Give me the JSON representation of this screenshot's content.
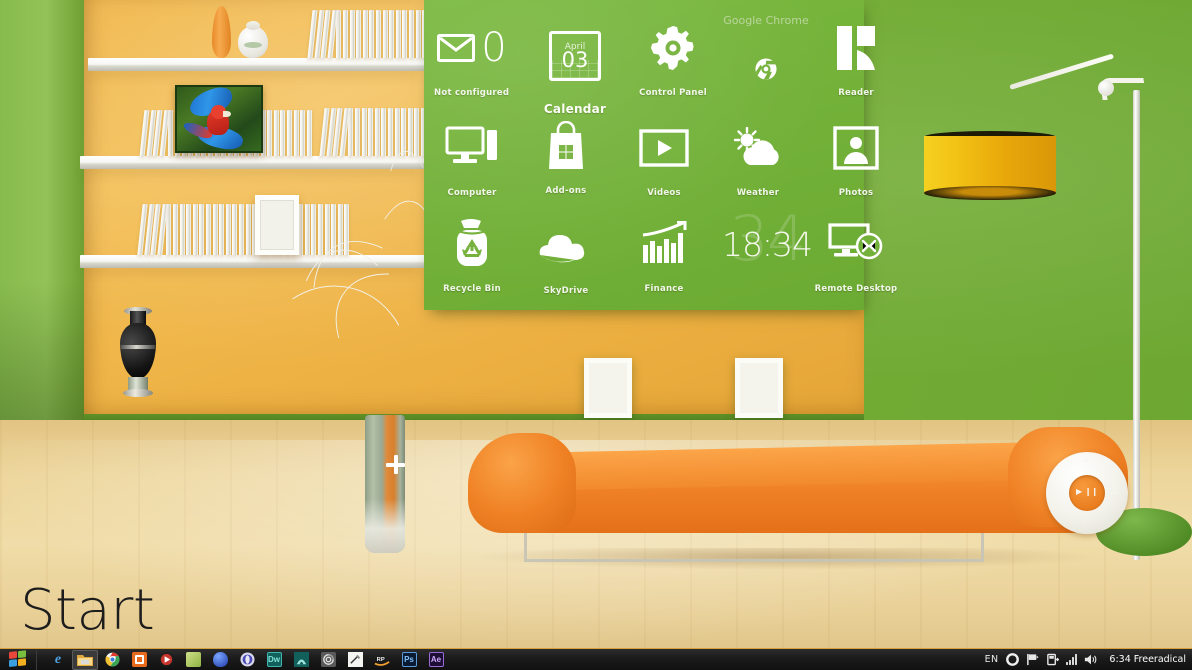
{
  "desktop": {
    "start_label": "Start",
    "wallpaper_name": "living-room-green-orange"
  },
  "tiles": [
    {
      "name": "mail",
      "label": "Not configured",
      "icon": "mail-icon",
      "count": "0",
      "label_style": "left"
    },
    {
      "name": "calendar",
      "label": "Calendar",
      "icon": "calendar-icon",
      "month": "April",
      "day": "03",
      "label_style": "big"
    },
    {
      "name": "control-panel",
      "label": "Control Panel",
      "icon": "gear-icon"
    },
    {
      "name": "google-chrome",
      "label": "Google Chrome",
      "icon": "chrome-icon",
      "label_style": "above"
    },
    {
      "name": "reader",
      "label": "Reader",
      "icon": "reader-icon"
    },
    {
      "name": "computer",
      "label": "Computer",
      "icon": "monitor-icon"
    },
    {
      "name": "add-ons",
      "label": "Add-ons",
      "icon": "shopping-bag-icon"
    },
    {
      "name": "videos",
      "label": "Videos",
      "icon": "play-box-icon"
    },
    {
      "name": "weather",
      "label": "Weather",
      "icon": "sun-cloud-icon"
    },
    {
      "name": "photos",
      "label": "Photos",
      "icon": "photo-person-icon"
    },
    {
      "name": "recycle-bin",
      "label": "Recycle Bin",
      "icon": "recycle-bin-icon"
    },
    {
      "name": "skydrive",
      "label": "SkyDrive",
      "icon": "cloud-icon"
    },
    {
      "name": "finance",
      "label": "Finance",
      "icon": "bar-chart-arrow-icon"
    },
    {
      "name": "clock",
      "label": "",
      "icon": "clock-tile",
      "time": "18:34",
      "ghost": "34"
    },
    {
      "name": "remote-desktop",
      "label": "Remote Desktop",
      "icon": "remote-desktop-icon"
    }
  ],
  "media_player": {
    "plus": "+",
    "minus": "–",
    "prev": "⏮",
    "next": "⏭",
    "play_pause": "▶ ❙❙"
  },
  "taskbar": {
    "start_button": "start-orb",
    "pinned": [
      {
        "name": "internet-explorer",
        "glyph": "e",
        "color": "#1c5fb4",
        "text_color": "#63a7e8",
        "bg": "transparent"
      },
      {
        "name": "file-explorer",
        "glyph": "",
        "color": "#e8b84a",
        "text_color": "#ffffff",
        "bg": "#e8b84a",
        "active": true
      },
      {
        "name": "google-chrome",
        "glyph": "",
        "color": "#dd4b3e",
        "text_color": "#ffffff",
        "bg": "#dd4b3e"
      },
      {
        "name": "virtualbox",
        "glyph": "",
        "color": "#e86a1c",
        "text_color": "#ffffff",
        "bg": "#e86a1c"
      },
      {
        "name": "media-player",
        "glyph": "",
        "color": "#c8352c",
        "text_color": "#ffffff",
        "bg": "#2d2d2d"
      },
      {
        "name": "notepad-plus",
        "glyph": "",
        "color": "#9fbf5a",
        "text_color": "#ffffff",
        "bg": "#9fbf5a"
      },
      {
        "name": "blue-app",
        "glyph": "",
        "color": "#2d55c8",
        "text_color": "#ffffff",
        "bg": "#2d55c8"
      },
      {
        "name": "opera-browser",
        "glyph": "",
        "color": "#6a6ad0",
        "text_color": "#ffffff",
        "bg": "#3a3a6a"
      },
      {
        "name": "dreamweaver",
        "glyph": "Dw",
        "color": "#1d7d78",
        "text_color": "#8fe6df",
        "bg": "#17625e"
      },
      {
        "name": "teal-app",
        "glyph": "",
        "color": "#1d7d78",
        "text_color": "#b6ece6",
        "bg": "#17625e"
      },
      {
        "name": "spiral-app",
        "glyph": "",
        "color": "#9a9a9a",
        "text_color": "#ffffff",
        "bg": "#5c5c5c"
      },
      {
        "name": "white-tool-app",
        "glyph": "",
        "color": "#f2f2f2",
        "text_color": "#222222",
        "bg": "#f2f2f2"
      },
      {
        "name": "realplayer",
        "glyph": "RP",
        "color": "#f0a030",
        "text_color": "#ffffff",
        "bg": "#2d2d2d"
      },
      {
        "name": "photoshop",
        "glyph": "Ps",
        "color": "#3a7bd5",
        "text_color": "#7fc4ff",
        "bg": "#0d1b33"
      },
      {
        "name": "after-effects",
        "glyph": "Ae",
        "color": "#9a5ad8",
        "text_color": "#cfa8ff",
        "bg": "#1d0f33"
      }
    ],
    "tray": {
      "language": "EN",
      "icons": [
        "circle-ring-icon",
        "flag-icon",
        "device-eject-icon",
        "signal-bars-icon",
        "speaker-icon"
      ],
      "clock": "6:34 Freeradical"
    }
  },
  "colors": {
    "wall_green": "#74b13a",
    "alcove_orange": "#f0b545",
    "tile_panel": "#79b93e",
    "sofa_orange": "#ef8024",
    "lamp_shade": "#f3c415",
    "taskbar": "#1a1a1a",
    "taskbar_accent": "#d4a13c"
  }
}
